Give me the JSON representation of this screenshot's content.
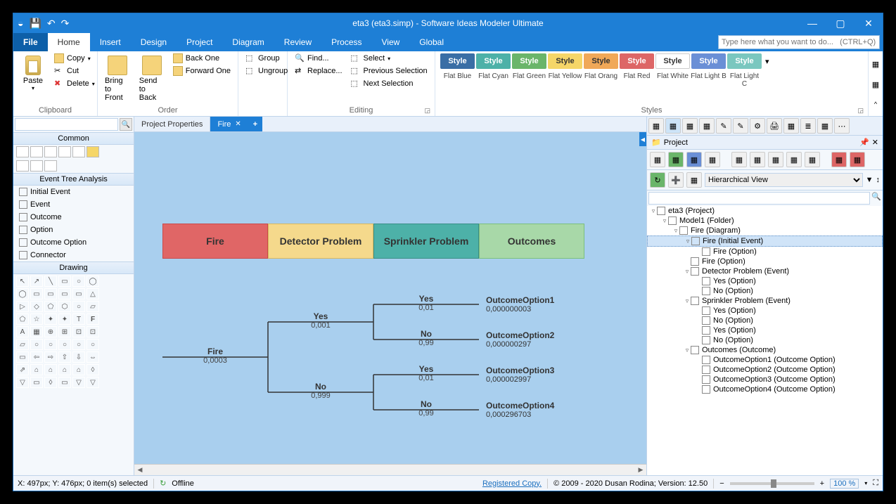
{
  "title": "eta3 (eta3.simp)  - Software Ideas Modeler Ultimate",
  "menus": [
    "File",
    "Home",
    "Insert",
    "Design",
    "Project",
    "Diagram",
    "Review",
    "Process",
    "View",
    "Global"
  ],
  "searchPlaceholder": "Type here what you want to do...   (CTRL+Q)",
  "ribbon": {
    "clipboard": {
      "paste": "Paste",
      "copy": "Copy",
      "cut": "Cut",
      "delete": "Delete",
      "label": "Clipboard"
    },
    "order": {
      "btf": "Bring to Front",
      "stb": "Send to Back",
      "back1": "Back One",
      "fwd1": "Forward One",
      "group": "Group",
      "ungroup": "Ungroup",
      "label": "Order"
    },
    "editing": {
      "find": "Find...",
      "replace": "Replace...",
      "select": "Select",
      "prevsel": "Previous Selection",
      "nextsel": "Next Selection",
      "label": "Editing"
    },
    "styles": {
      "style": "Style",
      "names": [
        "Flat Blue",
        "Flat Cyan",
        "Flat Green",
        "Flat Yellow",
        "Flat Orang",
        "Flat Red",
        "Flat White",
        "Flat Light B",
        "Flat Light C"
      ],
      "label": "Styles"
    }
  },
  "leftpanel": {
    "common": "Common",
    "eta": "Event Tree Analysis",
    "etaItems": [
      "Initial Event",
      "Event",
      "Outcome",
      "Option",
      "Outcome Option",
      "Connector"
    ],
    "drawing": "Drawing"
  },
  "tabs": {
    "prop": "Project Properties",
    "fire": "Fire"
  },
  "eta": {
    "headers": [
      "Fire",
      "Detector Problem",
      "Sprinkler Problem",
      "Outcomes"
    ],
    "root": {
      "label": "Fire",
      "prob": "0,0003"
    },
    "l1": {
      "yes": "Yes",
      "yprob": "0,001",
      "no": "No",
      "nprob": "0,999"
    },
    "l2": {
      "yes": "Yes",
      "yp": "0,01",
      "no": "No",
      "np": "0,99"
    },
    "outcomes": [
      {
        "n": "OutcomeOption1",
        "p": "0,000000003"
      },
      {
        "n": "OutcomeOption2",
        "p": "0,000000297"
      },
      {
        "n": "OutcomeOption3",
        "p": "0,000002997"
      },
      {
        "n": "OutcomeOption4",
        "p": "0,000296703"
      }
    ]
  },
  "project": {
    "title": "Project",
    "view": "Hierarchical View",
    "tree": [
      {
        "d": 0,
        "exp": "▿",
        "label": "eta3 (Project)"
      },
      {
        "d": 1,
        "exp": "▿",
        "label": "Model1 (Folder)"
      },
      {
        "d": 2,
        "exp": "▿",
        "label": "Fire (Diagram)"
      },
      {
        "d": 3,
        "exp": "▿",
        "label": "Fire (Initial Event)",
        "sel": true
      },
      {
        "d": 4,
        "exp": "",
        "label": "Fire (Option)"
      },
      {
        "d": 3,
        "exp": "",
        "label": "Fire (Option)"
      },
      {
        "d": 3,
        "exp": "▿",
        "label": "Detector Problem (Event)"
      },
      {
        "d": 4,
        "exp": "",
        "label": "Yes (Option)"
      },
      {
        "d": 4,
        "exp": "",
        "label": "No (Option)"
      },
      {
        "d": 3,
        "exp": "▿",
        "label": "Sprinkler Problem (Event)"
      },
      {
        "d": 4,
        "exp": "",
        "label": "Yes (Option)"
      },
      {
        "d": 4,
        "exp": "",
        "label": "No (Option)"
      },
      {
        "d": 4,
        "exp": "",
        "label": "Yes (Option)"
      },
      {
        "d": 4,
        "exp": "",
        "label": "No (Option)"
      },
      {
        "d": 3,
        "exp": "▿",
        "label": "Outcomes (Outcome)"
      },
      {
        "d": 4,
        "exp": "",
        "label": "OutcomeOption1 (Outcome Option)"
      },
      {
        "d": 4,
        "exp": "",
        "label": "OutcomeOption2 (Outcome Option)"
      },
      {
        "d": 4,
        "exp": "",
        "label": "OutcomeOption3 (Outcome Option)"
      },
      {
        "d": 4,
        "exp": "",
        "label": "OutcomeOption4 (Outcome Option)"
      }
    ]
  },
  "status": {
    "coords": "X: 497px; Y: 476px; 0 item(s) selected",
    "offline": "Offline",
    "reg": "Registered Copy.",
    "copy": "© 2009 - 2020 Dusan Rodina; Version: 12.50",
    "zoom": "100 %"
  },
  "chart_data": {
    "type": "event-tree",
    "title": "Fire Event Tree Analysis",
    "initial_event": {
      "name": "Fire",
      "probability": 0.0003
    },
    "events": [
      {
        "name": "Detector Problem",
        "branches": [
          {
            "label": "Yes",
            "probability": 0.001
          },
          {
            "label": "No",
            "probability": 0.999
          }
        ]
      },
      {
        "name": "Sprinkler Problem",
        "branches": [
          {
            "label": "Yes",
            "probability": 0.01
          },
          {
            "label": "No",
            "probability": 0.99
          }
        ]
      }
    ],
    "outcomes": [
      {
        "name": "OutcomeOption1",
        "path": [
          "Yes",
          "Yes"
        ],
        "probability": 3e-09
      },
      {
        "name": "OutcomeOption2",
        "path": [
          "Yes",
          "No"
        ],
        "probability": 2.97e-07
      },
      {
        "name": "OutcomeOption3",
        "path": [
          "No",
          "Yes"
        ],
        "probability": 2.997e-06
      },
      {
        "name": "OutcomeOption4",
        "path": [
          "No",
          "No"
        ],
        "probability": 0.000296703
      }
    ]
  }
}
